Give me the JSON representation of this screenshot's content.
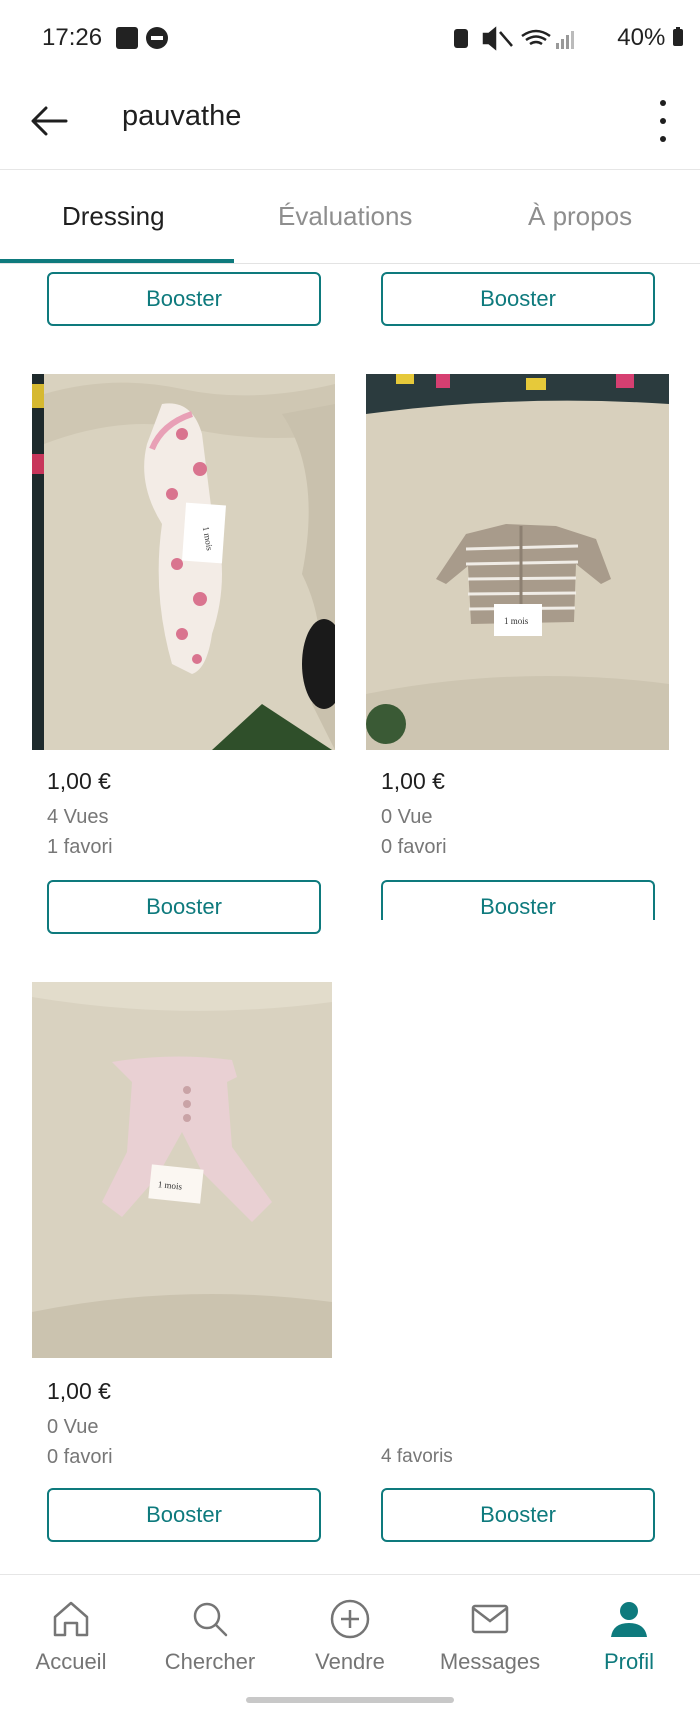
{
  "status_bar": {
    "time": "17:26",
    "battery": "40%",
    "icons": [
      "image-icon",
      "dnd-icon",
      "nfc-icon",
      "mute-icon",
      "wifi-icon",
      "signal-icon",
      "battery-icon"
    ]
  },
  "header": {
    "title": "pauvathe",
    "back_icon": "arrow-left-icon",
    "menu_icon": "more-vertical-icon"
  },
  "tabs": [
    {
      "label": "Dressing",
      "active": true
    },
    {
      "label": "Évaluations",
      "active": false
    },
    {
      "label": "À propos",
      "active": false
    }
  ],
  "top_row": {
    "left_booster": "Booster",
    "right_booster": "Booster"
  },
  "items": [
    {
      "price": "1,00 €",
      "views": "4 Vues",
      "favs": "1 favori",
      "booster": "Booster",
      "photo_label": "1 mois"
    },
    {
      "price": "1,00 €",
      "views": "0 Vue",
      "favs": "0 favori",
      "booster": "Booster",
      "photo_label": "1 mois"
    },
    {
      "price": "1,00 €",
      "views": "0 Vue",
      "favs": "0 favori",
      "booster": "Booster",
      "photo_label": "1 mois"
    }
  ],
  "ghost_right": {
    "favs": "4 favoris",
    "booster": "Booster"
  },
  "bottom_nav": [
    {
      "label": "Accueil",
      "icon": "home-icon",
      "active": false
    },
    {
      "label": "Chercher",
      "icon": "search-icon",
      "active": false
    },
    {
      "label": "Vendre",
      "icon": "plus-circle-icon",
      "active": false
    },
    {
      "label": "Messages",
      "icon": "mail-icon",
      "active": false
    },
    {
      "label": "Profil",
      "icon": "profile-icon",
      "active": true
    }
  ],
  "colors": {
    "accent": "#0e7a7d",
    "text": "#1f1f1f",
    "muted": "#777777"
  }
}
